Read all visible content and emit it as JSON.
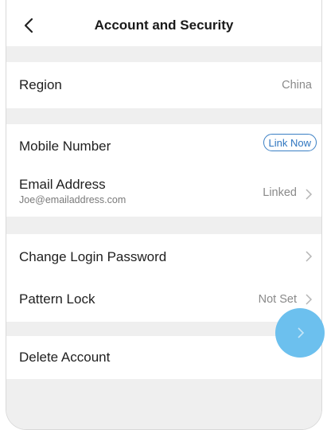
{
  "header": {
    "title": "Account and Security"
  },
  "rows": {
    "region": {
      "label": "Region",
      "value": "China"
    },
    "mobile": {
      "label": "Mobile Number",
      "button": "Link Now"
    },
    "email": {
      "label": "Email Address",
      "sub": "Joe@emailaddress.com",
      "value": "Linked"
    },
    "password": {
      "label": "Change Login Password"
    },
    "pattern": {
      "label": "Pattern Lock",
      "value": "Not Set"
    },
    "delete": {
      "label": "Delete Account"
    }
  },
  "icons": {
    "back": "chevron-left-icon",
    "row_chevron": "chevron-right-icon"
  },
  "colors": {
    "accent": "#2f76c0",
    "fab": "#6cc0ee",
    "separator": "#efefef"
  }
}
